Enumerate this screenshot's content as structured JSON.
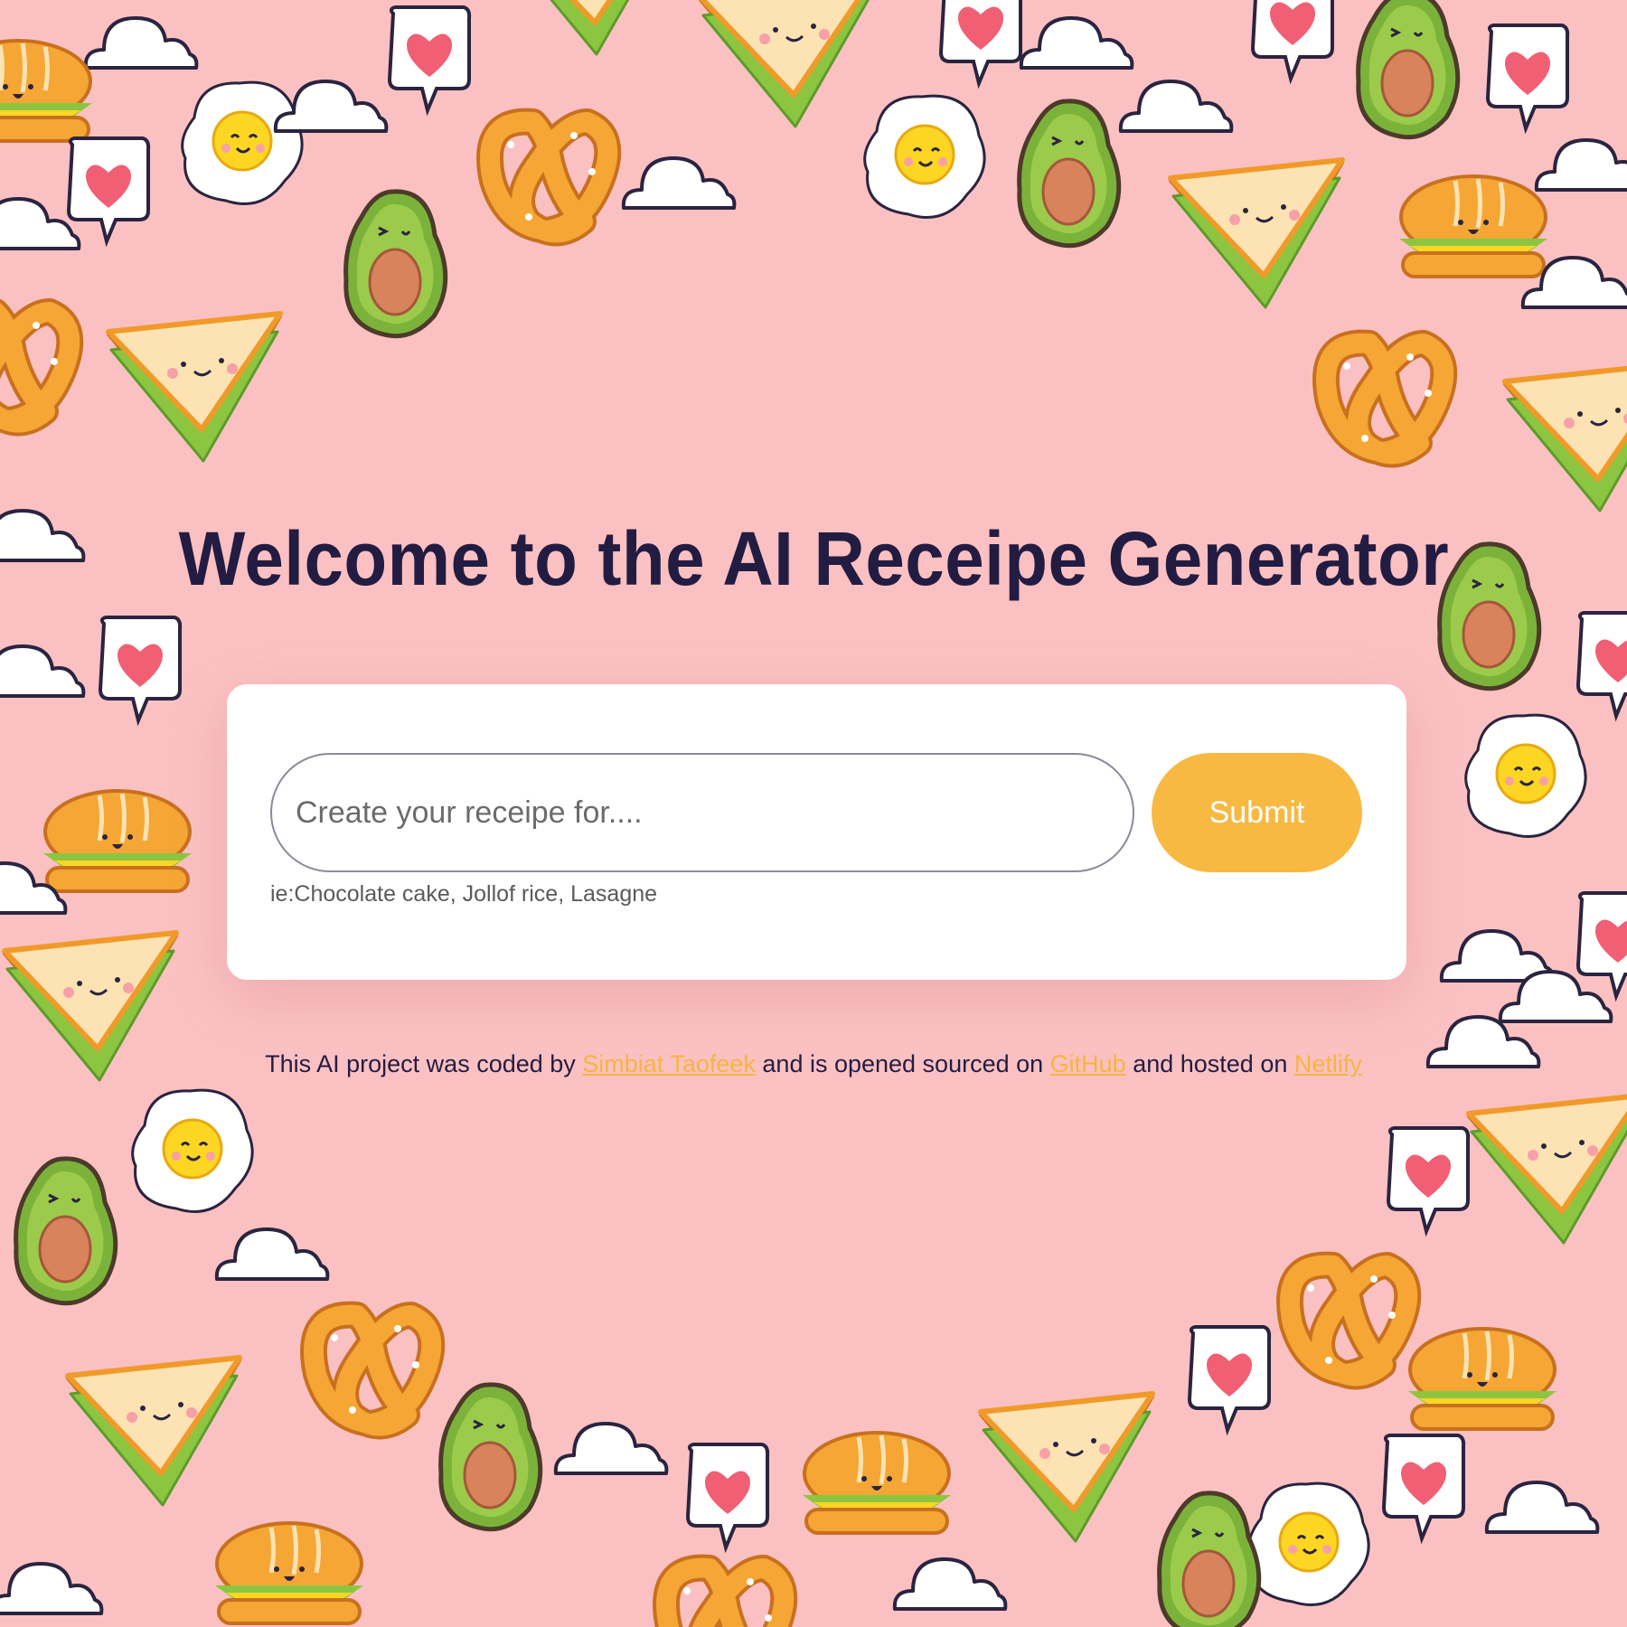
{
  "page": {
    "title": "Welcome to the AI Receipe Generator"
  },
  "form": {
    "input_placeholder": "Create your receipe for....",
    "input_value": "",
    "submit_label": "Submit",
    "hint": "ie:Chocolate cake, Jollof rice, Lasagne"
  },
  "footer": {
    "text_1": "This AI project was coded by ",
    "author_link": "Simbiat Taofeek",
    "text_2": " and is opened sourced on ",
    "github_link": "GitHub",
    "text_3": " and hosted on ",
    "netlify_link": "Netlify"
  },
  "theme": {
    "background": "#fbc1c2",
    "title_color": "#231c42",
    "accent": "#f7b942",
    "link_color": "#f5b53f",
    "card_background": "#ffffff"
  },
  "decorations": {
    "icons": [
      "sandwich-icon",
      "fried-egg-icon",
      "avocado-icon",
      "pretzel-icon",
      "burger-icon",
      "heart-bubble-icon",
      "cloud-icon"
    ]
  }
}
